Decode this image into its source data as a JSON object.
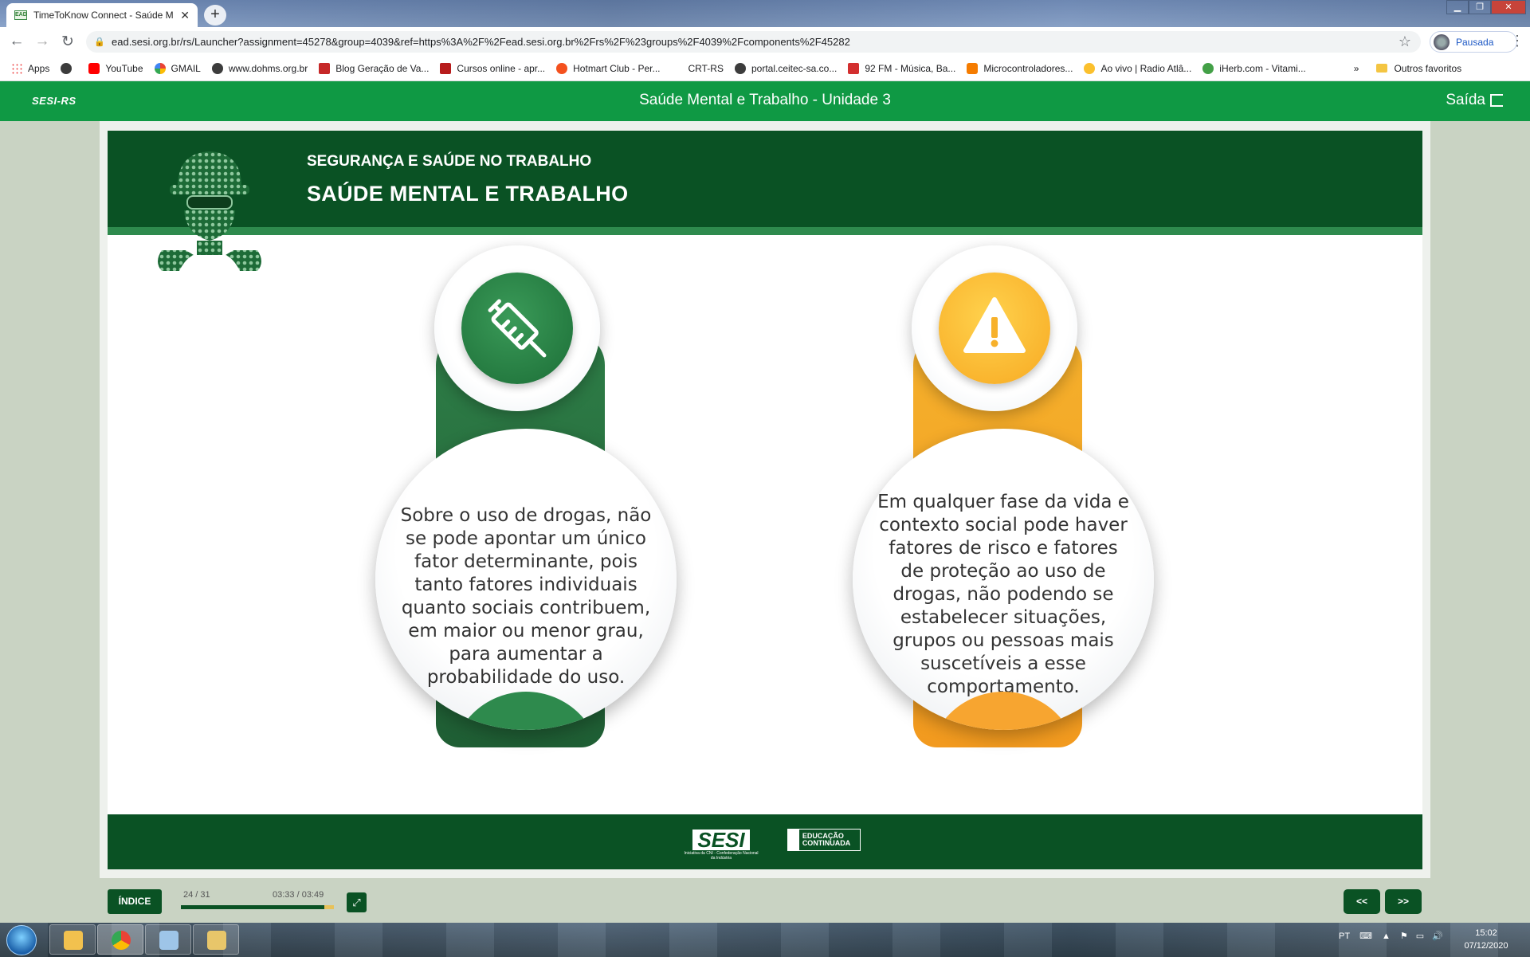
{
  "browser": {
    "tab_title": "TimeToKnow Connect - Saúde M",
    "tab_favicon_text": "EAD",
    "url": "ead.sesi.org.br/rs/Launcher?assignment=45278&group=4039&ref=https%3A%2F%2Fead.sesi.org.br%2Frs%2F%23groups%2F4039%2Fcomponents%2F45282",
    "profile_label": "Pausada",
    "bookmarks": [
      "Apps",
      "YouTube",
      "GMAIL",
      "www.dohms.org.br",
      "Blog Geração de Va...",
      "Cursos online - apr...",
      "Hotmart Club - Per...",
      "CRT-RS",
      "portal.ceitec-sa.co...",
      "92 FM - Música, Ba...",
      "Microcontroladores...",
      "Ao vivo | Radio Atlâ...",
      "iHerb.com - Vitami..."
    ],
    "bookmark_more": "»",
    "other_bookmarks": "Outros favoritos"
  },
  "app": {
    "brand": "SESI-RS",
    "title": "Saúde Mental e Trabalho - Unidade 3",
    "exit_label": "Saída"
  },
  "course": {
    "subtitle": "SEGURANÇA E SAÚDE NO TRABALHO",
    "title": "SAÚDE MENTAL E TRABALHO",
    "cards": [
      {
        "icon": "syringe-icon",
        "color": "#2e8a4d",
        "text": "Sobre o uso de drogas, não se pode apontar um único fator determinante, pois tanto fatores individuais quanto sociais contribuem, em maior ou menor grau, para aumentar a probabilidade do uso."
      },
      {
        "icon": "warning-icon",
        "color": "#f7b12b",
        "text": "Em qualquer fase da vida e contexto social pode haver fatores de risco e fatores de proteção ao uso de drogas, não podendo se estabelecer situações, grupos ou pessoas mais suscetíveis a esse comportamento."
      }
    ],
    "footer_logo_main": "SESI",
    "footer_logo_small": "Iniciativa da CNI - Confederação Nacional da Indústria",
    "footer_logo_edu": "EDUCAÇÃO CONTINUADA"
  },
  "controls": {
    "index_label": "ÍNDICE",
    "page_count": "24 / 31",
    "time": "03:33 / 03:49",
    "progress_fraction": 0.94,
    "prev_label": "<<",
    "next_label": ">>"
  },
  "taskbar": {
    "language": "PT",
    "time": "15:02",
    "date": "07/12/2020"
  }
}
